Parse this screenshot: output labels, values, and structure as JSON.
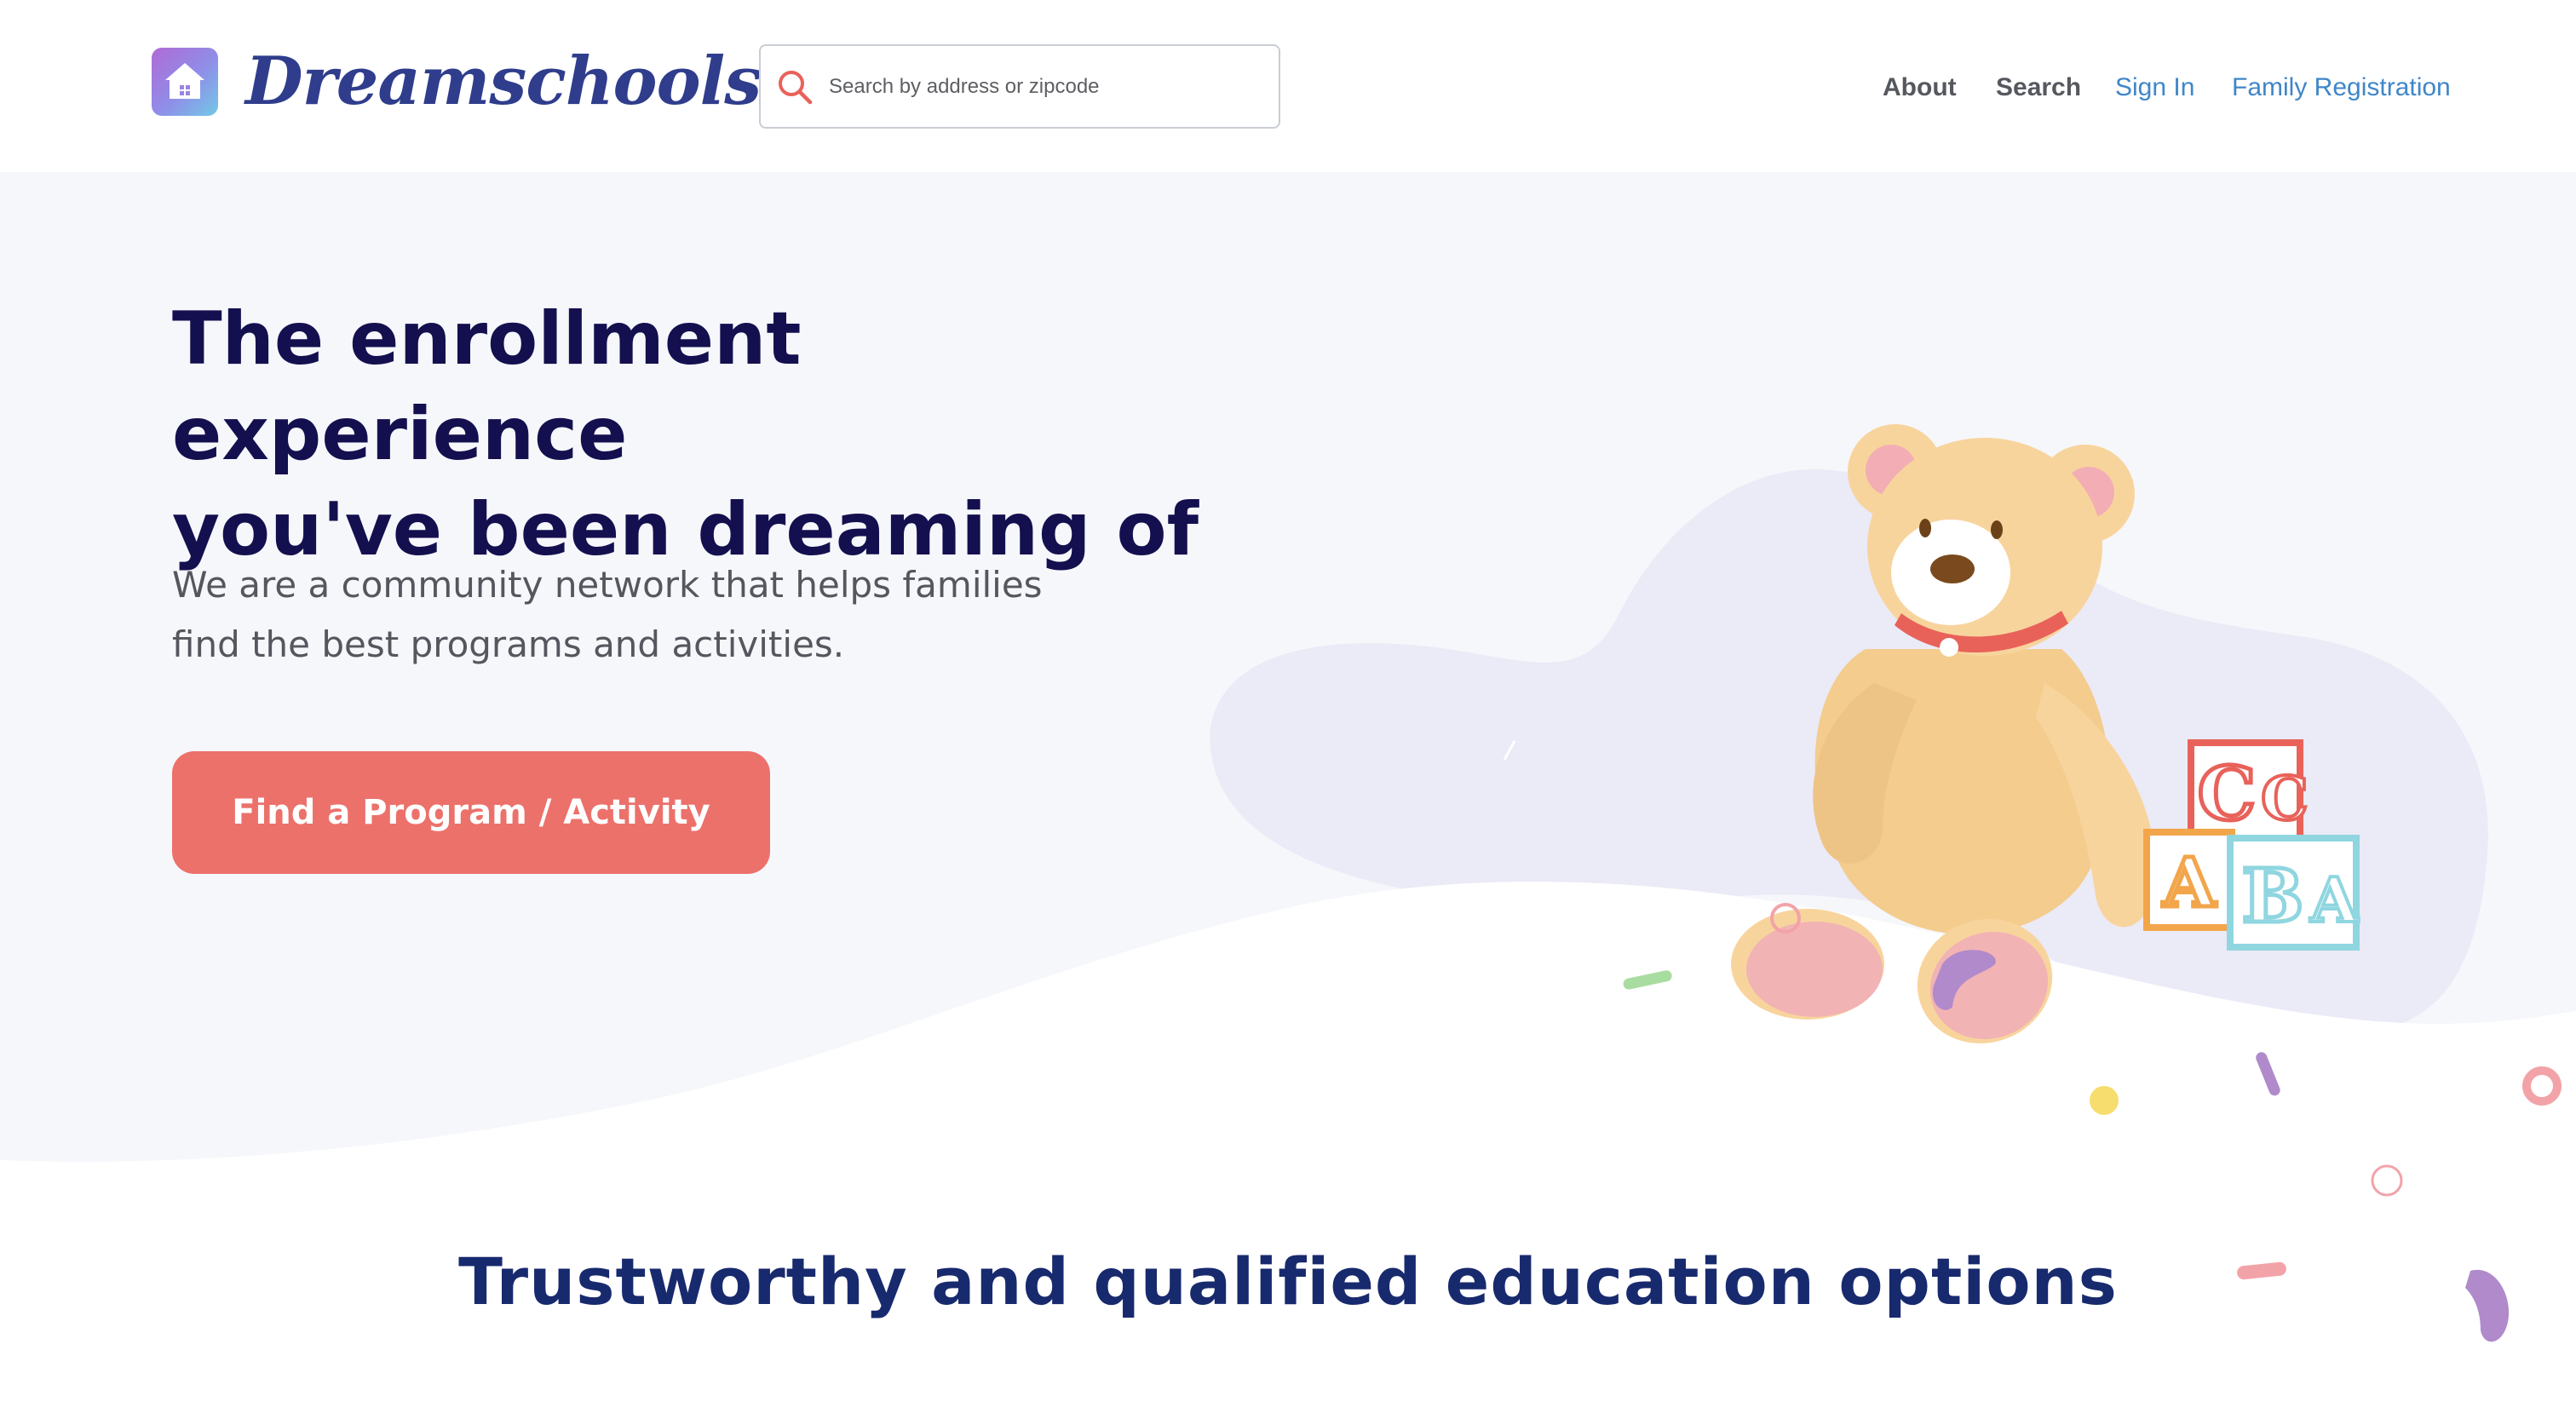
{
  "header": {
    "brand": "Dreamschools",
    "logo_icon": "house-icon",
    "search": {
      "placeholder": "Search by address or zipcode",
      "value": "",
      "icon": "search-icon"
    },
    "nav": [
      {
        "label": "About"
      },
      {
        "label": "Search"
      },
      {
        "label": "Sign In"
      },
      {
        "label": "Family Registration"
      }
    ]
  },
  "hero": {
    "title_line1": "The enrollment experience",
    "title_line2": "you've been dreaming of",
    "subtitle_line1": "We are a community network that helps families",
    "subtitle_line2": "find the best programs and activities.",
    "cta_label": "Find a Program / Activity",
    "illustration": "teddy-bear-with-abc-blocks-illustration",
    "block_letters": [
      "C",
      "C",
      "A",
      "B",
      "A"
    ]
  },
  "section": {
    "title": "Trustworthy and qualified education options"
  },
  "colors": {
    "brand_text": "#2f3d8c",
    "hero_title": "#14104f",
    "cta": "#ec716b",
    "nav_link_blue": "#3f86c9",
    "section_title": "#182a6e"
  }
}
